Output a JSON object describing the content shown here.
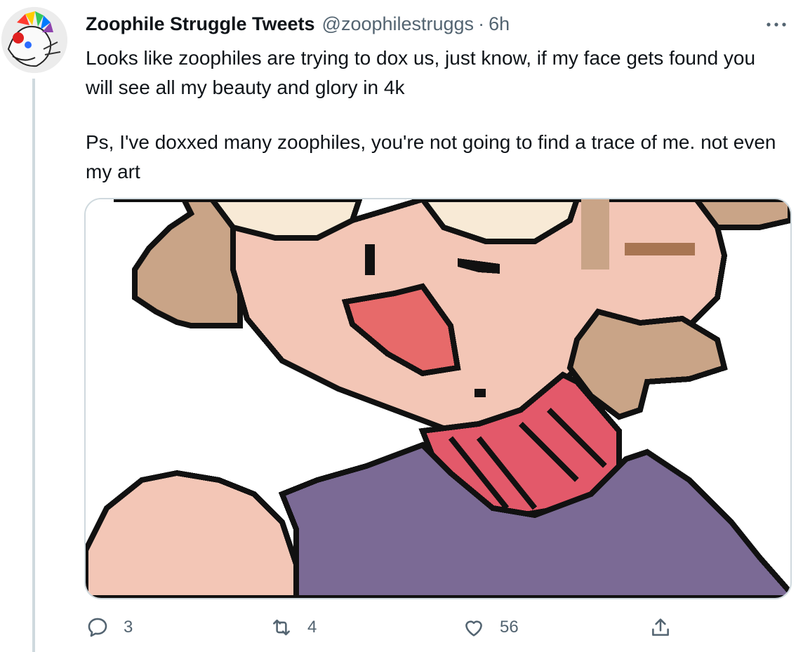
{
  "tweet": {
    "display_name": "Zoophile Struggle Tweets",
    "handle": "@zoophilestruggs",
    "separator": "·",
    "time": "6h",
    "more_icon": "more-horizontal-icon",
    "paragraphs": [
      "Looks like zoophiles are trying to dox us, just know, if my face gets found you will see all my beauty and glory in 4k",
      "Ps, I've doxxed many zoophiles, you're not going to find a trace of me. not even my art"
    ],
    "actions": {
      "reply": {
        "icon": "reply-icon",
        "count": "3"
      },
      "retweet": {
        "icon": "retweet-icon",
        "count": "4"
      },
      "like": {
        "icon": "heart-icon",
        "count": "56"
      },
      "share": {
        "icon": "share-icon"
      }
    }
  },
  "colors": {
    "text_primary": "#0f1419",
    "text_secondary": "#536471",
    "border": "#cfd9de",
    "skin": "#f3c6b6",
    "hair_light": "#f8ead6",
    "hair_brown": "#c9a487",
    "tongue": "#e76a6a",
    "scarf": "#e3596a",
    "shirt": "#7b6a95",
    "outline": "#111111"
  }
}
